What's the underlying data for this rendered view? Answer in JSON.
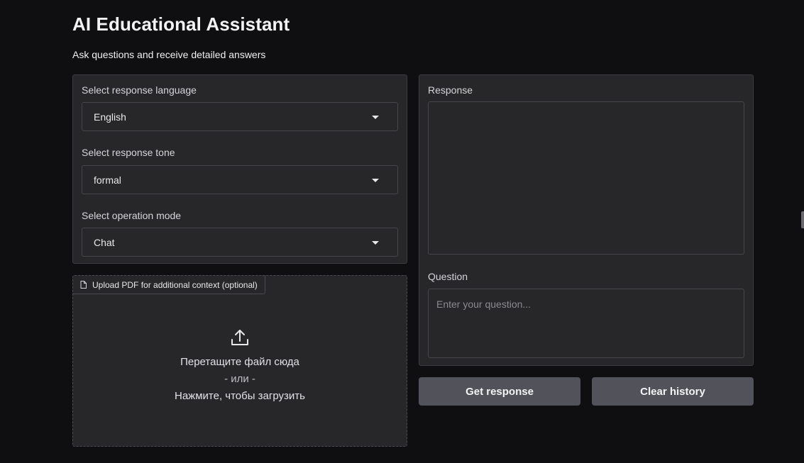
{
  "header": {
    "title": "AI Educational Assistant",
    "subtitle": "Ask questions and receive detailed answers"
  },
  "settings": {
    "language": {
      "label": "Select response language",
      "value": "English"
    },
    "tone": {
      "label": "Select response tone",
      "value": "formal"
    },
    "mode": {
      "label": "Select operation mode",
      "value": "Chat"
    }
  },
  "upload": {
    "badge_label": "Upload PDF for additional context (optional)",
    "drop_text": "Перетащите файл сюда",
    "or_text": "- или -",
    "click_text": "Нажмите, чтобы загрузить",
    "badge_icon": "file-icon",
    "main_icon": "upload-icon"
  },
  "response": {
    "label": "Response",
    "value": ""
  },
  "question": {
    "label": "Question",
    "placeholder": "Enter your question..."
  },
  "actions": {
    "get_response": "Get response",
    "clear_history": "Clear history"
  },
  "colors": {
    "background": "#0f0f11",
    "panel": "#27272a",
    "button": "#52525b",
    "border": "#3c3c41"
  }
}
